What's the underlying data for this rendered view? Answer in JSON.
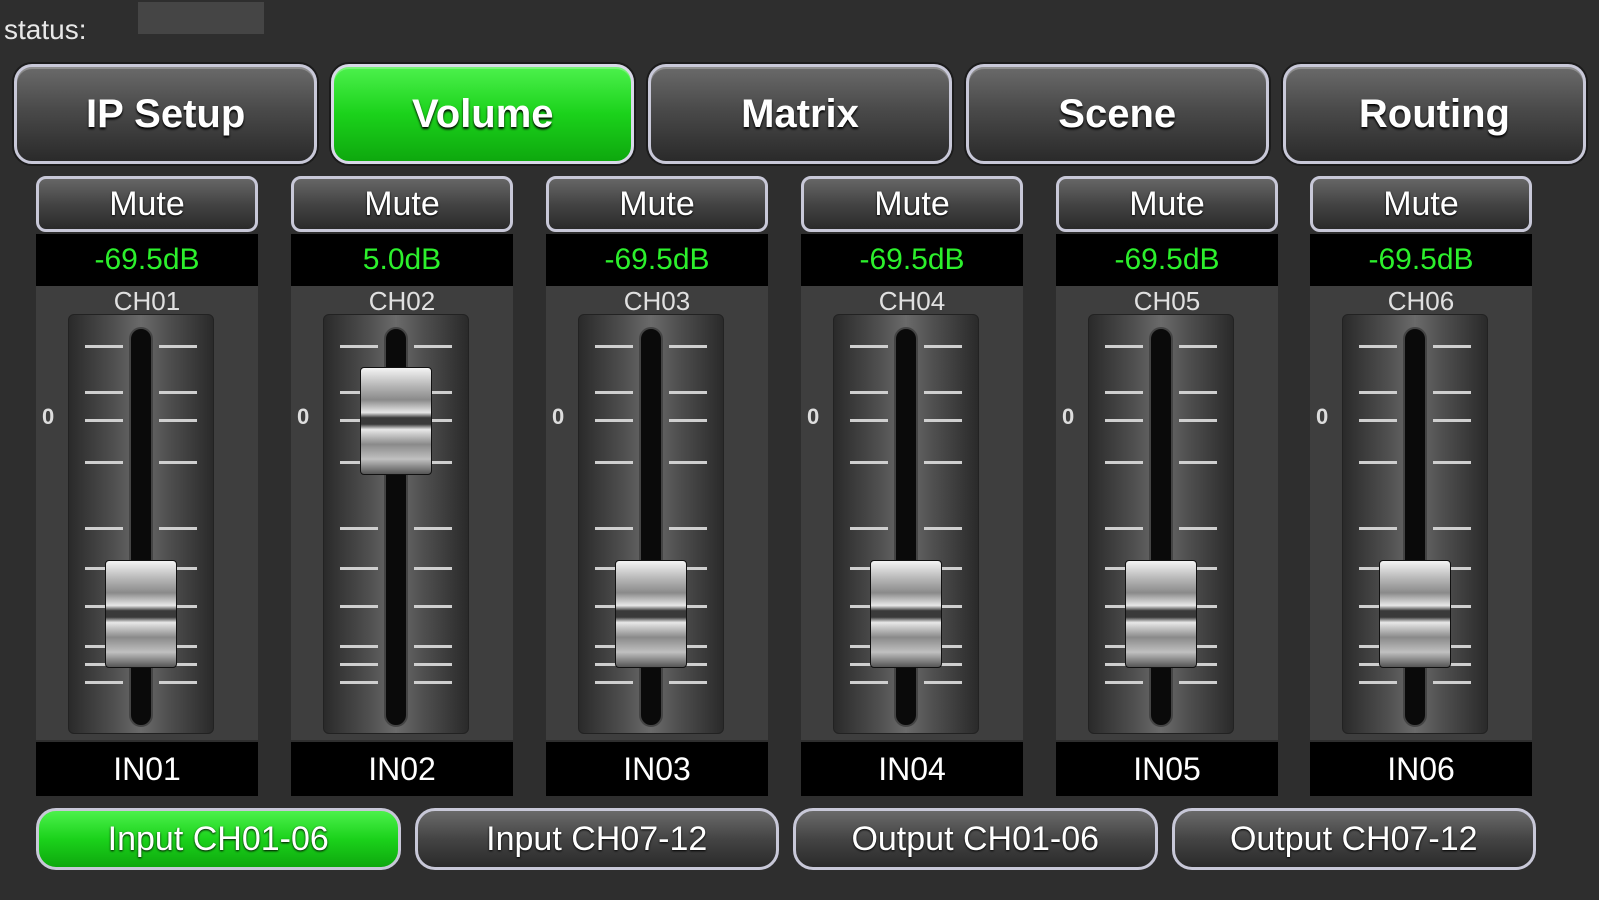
{
  "status": {
    "label": "status:",
    "value": ""
  },
  "tabs": [
    {
      "label": "IP Setup",
      "active": false
    },
    {
      "label": "Volume",
      "active": true
    },
    {
      "label": "Matrix",
      "active": false
    },
    {
      "label": "Scene",
      "active": false
    },
    {
      "label": "Routing",
      "active": false
    }
  ],
  "channels": [
    {
      "mute_label": "Mute",
      "level": "-69.5dB",
      "name": "CH01",
      "zero_mark": "0",
      "input": "IN01",
      "fader_position": 0.2
    },
    {
      "mute_label": "Mute",
      "level": "5.0dB",
      "name": "CH02",
      "zero_mark": "0",
      "input": "IN02",
      "fader_position": 0.85
    },
    {
      "mute_label": "Mute",
      "level": "-69.5dB",
      "name": "CH03",
      "zero_mark": "0",
      "input": "IN03",
      "fader_position": 0.2
    },
    {
      "mute_label": "Mute",
      "level": "-69.5dB",
      "name": "CH04",
      "zero_mark": "0",
      "input": "IN04",
      "fader_position": 0.2
    },
    {
      "mute_label": "Mute",
      "level": "-69.5dB",
      "name": "CH05",
      "zero_mark": "0",
      "input": "IN05",
      "fader_position": 0.2
    },
    {
      "mute_label": "Mute",
      "level": "-69.5dB",
      "name": "CH06",
      "zero_mark": "0",
      "input": "IN06",
      "fader_position": 0.2
    }
  ],
  "bottom_tabs": [
    {
      "label": "Input CH01-06",
      "active": true
    },
    {
      "label": "Input CH07-12",
      "active": false
    },
    {
      "label": "Output CH01-06",
      "active": false
    },
    {
      "label": "Output CH07-12",
      "active": false
    }
  ],
  "colors": {
    "accent_green": "#1bd21b",
    "level_text": "#2cf02c",
    "background": "#2e2e2e"
  }
}
